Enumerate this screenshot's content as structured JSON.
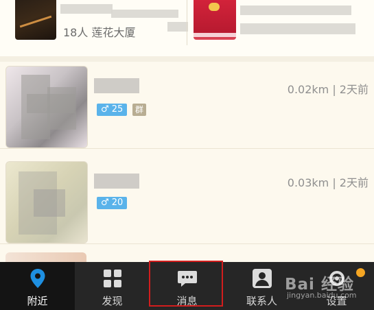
{
  "top_item": {
    "subtitle": "18人 莲花大厦"
  },
  "list": [
    {
      "distance_time": "0.02km | 2天前",
      "gender_age": "♂ 25",
      "group_badge": "群"
    },
    {
      "distance_time": "0.03km | 2天前",
      "gender_age": "♂ 20"
    }
  ],
  "tabs": [
    {
      "label": "附近",
      "icon": "location-pin-icon",
      "active": true
    },
    {
      "label": "发现",
      "icon": "grid-icon"
    },
    {
      "label": "消息",
      "icon": "message-bubble-icon"
    },
    {
      "label": "联系人",
      "icon": "contacts-icon"
    },
    {
      "label": "设置",
      "icon": "settings-icon"
    }
  ],
  "colors": {
    "accent_blue": "#1e8fe1",
    "gender_badge": "#5ab3ea",
    "group_badge": "#b8ad92",
    "tabbar_bg": "#262626",
    "highlight": "#d31d1d",
    "notification_dot": "#f5a623"
  },
  "watermark": {
    "brand": "Bai 经验",
    "url": "jingyan.baidu.com"
  }
}
